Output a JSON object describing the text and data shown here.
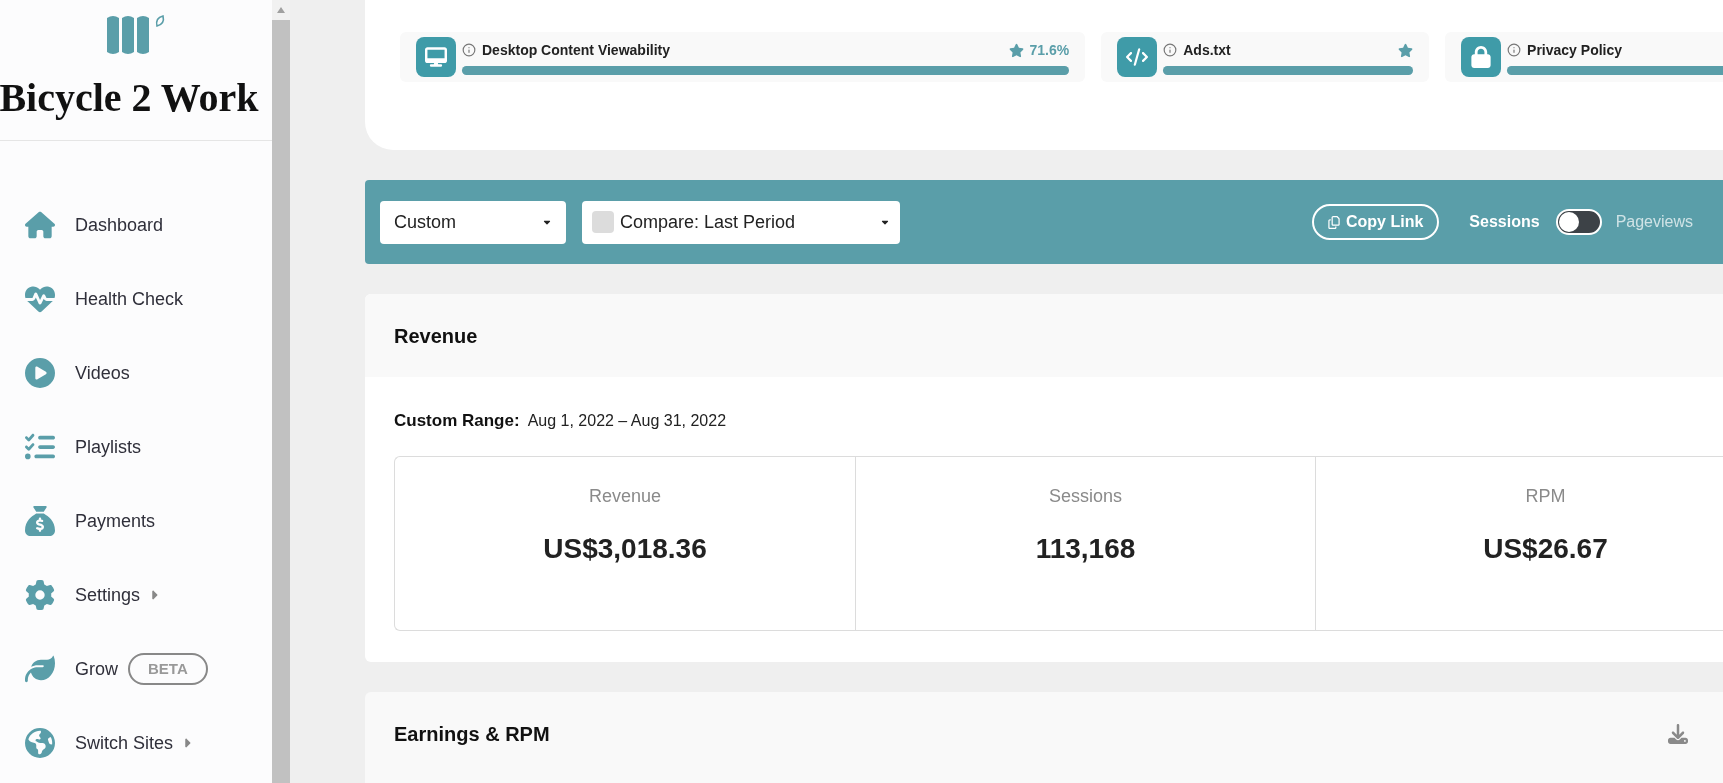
{
  "sidebar": {
    "site_name": "Bicycle 2 Work",
    "items": [
      {
        "label": "Dashboard",
        "has_arrow": false
      },
      {
        "label": "Health Check",
        "has_arrow": false
      },
      {
        "label": "Videos",
        "has_arrow": false
      },
      {
        "label": "Playlists",
        "has_arrow": false
      },
      {
        "label": "Payments",
        "has_arrow": false
      },
      {
        "label": "Settings",
        "has_arrow": true
      },
      {
        "label": "Grow",
        "has_arrow": false,
        "badge": "BETA"
      },
      {
        "label": "Switch Sites",
        "has_arrow": true
      }
    ]
  },
  "health_items": [
    {
      "kind": "viewability",
      "title": "Desktop Content Viewability",
      "starred": true,
      "reading": "71.6%",
      "level": 1
    },
    {
      "kind": "code",
      "title": "Ads.txt",
      "starred": true,
      "level": 1
    },
    {
      "kind": "lock",
      "title": "Privacy Policy",
      "level": 1
    }
  ],
  "toolbar": {
    "range_select": "Custom",
    "compare": {
      "checked": false,
      "label": "Compare: Last Period"
    },
    "copy_link": "Copy Link",
    "toggle": {
      "left_label": "Sessions",
      "right_label": "Pageviews",
      "on": false
    }
  },
  "revenue": {
    "title": "Revenue",
    "range_label": "Custom Range:",
    "range_value": "Aug 1, 2022 – Aug 31, 2022",
    "stats": [
      {
        "label": "Revenue",
        "value": "US$3,018.36"
      },
      {
        "label": "Sessions",
        "value": "113,168"
      },
      {
        "label": "RPM",
        "value": "US$26.67"
      }
    ]
  },
  "earnings": {
    "title": "Earnings & RPM"
  }
}
